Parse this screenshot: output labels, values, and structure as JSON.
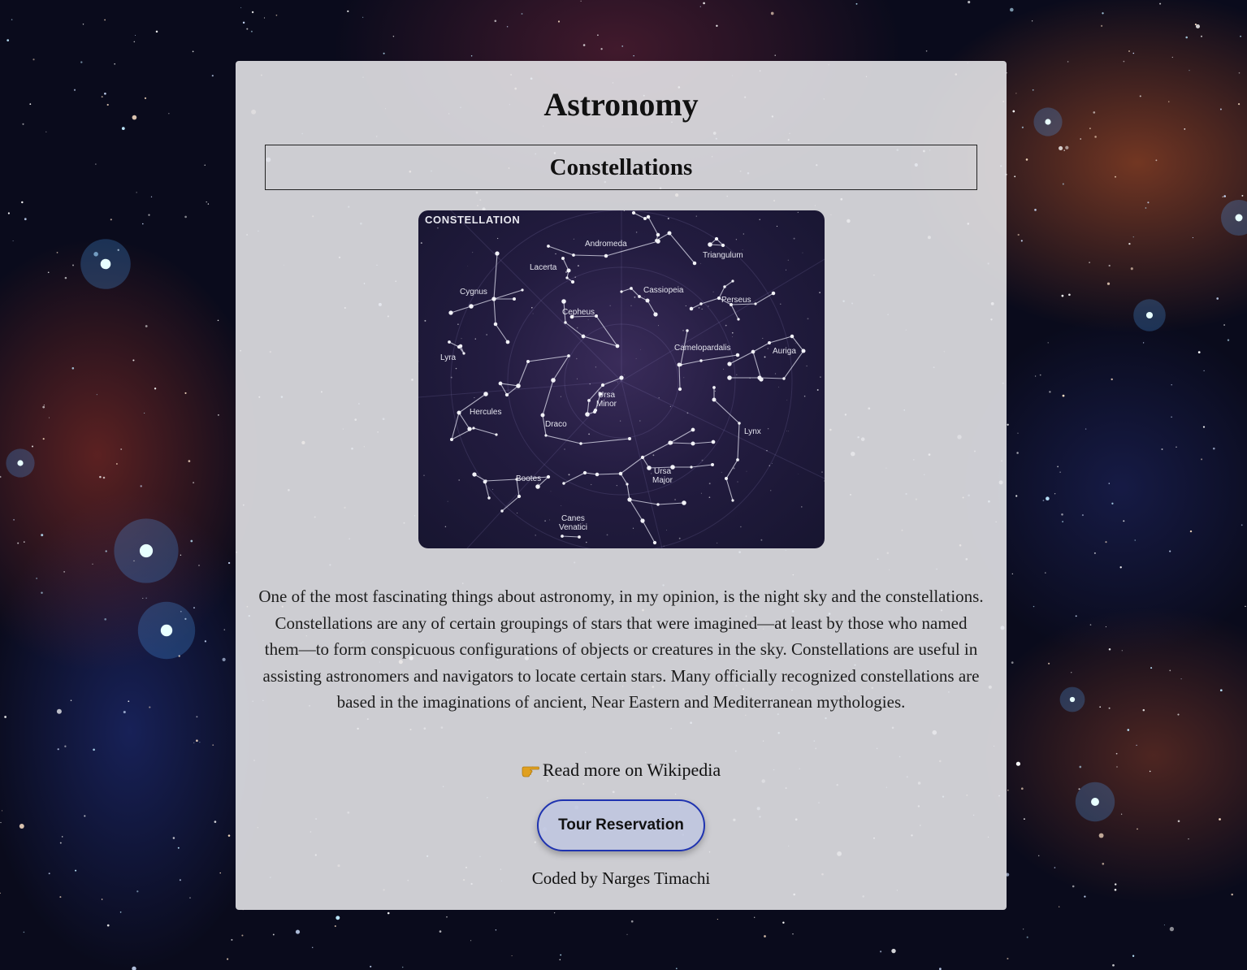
{
  "page": {
    "title": "Astronomy",
    "section_title": "Constellations",
    "image": {
      "heading": "CONSTELLATION",
      "labels": [
        "Andromeda",
        "Triangulum",
        "Lacerta",
        "Cygnus",
        "Cassiopeia",
        "Cepheus",
        "Perseus",
        "Lyra",
        "Camelopardalis",
        "Auriga",
        "Ursa",
        "Minor",
        "Hercules",
        "Draco",
        "Lynx",
        "Ursa",
        "Major",
        "Bootes",
        "Canes",
        "Venatici"
      ]
    },
    "description": "One of the most fascinating things about astronomy, in my opinion, is the night sky and the constellations. Constellations are any of certain groupings of stars that were imagined—at least by those who named them—to form conspicuous configurations of objects or creatures in the sky. Constellations are useful in assisting astronomers and navigators to locate certain stars. Many officially recognized constellations are based in the imaginations of ancient, Near Eastern and Mediterranean mythologies.",
    "wiki_link": "Read more on Wikipedia",
    "button_label": "Tour Reservation",
    "credit": "Coded by Narges Timachi"
  },
  "colors": {
    "button_border": "#1f33b0",
    "button_bg": "#bec6e0",
    "card_bg": "#e8e8ec",
    "map_bg": "#231c40",
    "hand_icon": "#e0a020"
  }
}
